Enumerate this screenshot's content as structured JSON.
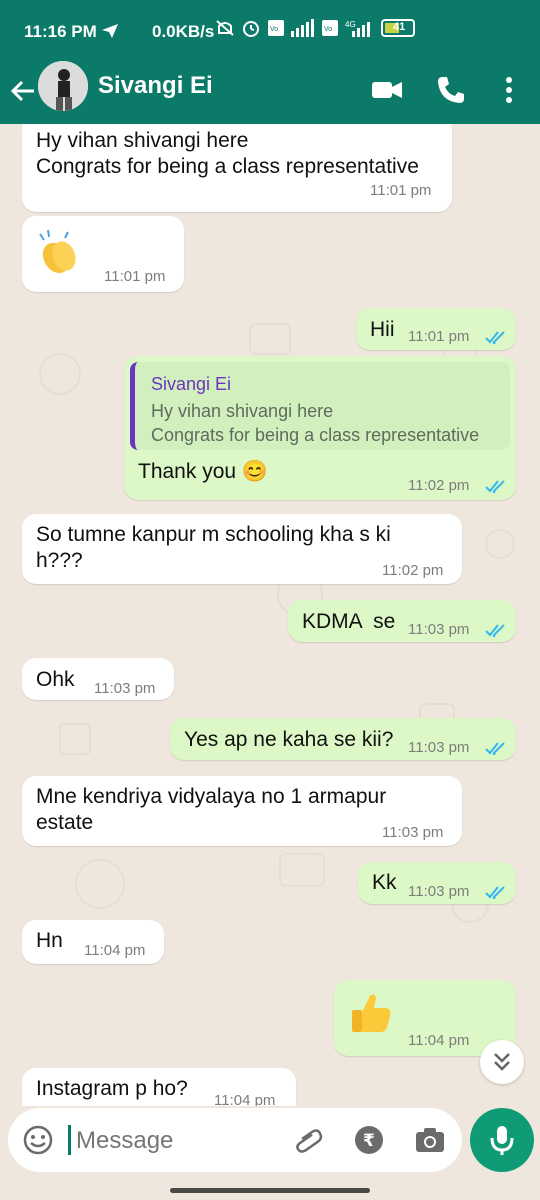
{
  "status_bar": {
    "time": "11:16 PM",
    "speed": "0.0KB/s",
    "battery": "41"
  },
  "header": {
    "contact_name": "Sivangi Ei"
  },
  "messages": [
    {
      "text": "Hy vihan shivangi here\nCongrats for being a class representative",
      "time": "11:01 pm",
      "direction": "incoming"
    },
    {
      "emoji": "clapping-hands",
      "time": "11:01 pm",
      "direction": "incoming"
    },
    {
      "text": "Hii",
      "time": "11:01 pm",
      "direction": "outgoing"
    },
    {
      "reply_name": "Sivangi Ei",
      "reply_text": "Hy vihan shivangi here\nCongrats for being a class representative",
      "text": "Thank you 😊",
      "time": "11:02 pm",
      "direction": "outgoing"
    },
    {
      "text": "So tumne kanpur m schooling kha s ki\nh???",
      "time": "11:02 pm",
      "direction": "incoming"
    },
    {
      "text": "KDMA  se",
      "time": "11:03 pm",
      "direction": "outgoing"
    },
    {
      "text": "Ohk",
      "time": "11:03 pm",
      "direction": "incoming"
    },
    {
      "text": "Yes ap ne kaha se kii?",
      "time": "11:03 pm",
      "direction": "outgoing"
    },
    {
      "text": "Mne kendriya vidyalaya no 1 armapur\nestate",
      "time": "11:03 pm",
      "direction": "incoming"
    },
    {
      "text": "Kk",
      "time": "11:03 pm",
      "direction": "outgoing"
    },
    {
      "text": "Hn",
      "time": "11:04 pm",
      "direction": "incoming"
    },
    {
      "emoji": "thumbs-up",
      "time": "11:04 pm",
      "direction": "outgoing"
    },
    {
      "text": "Instagram p ho?",
      "time": "11:04 pm",
      "direction": "incoming"
    }
  ],
  "composer": {
    "placeholder": "Message"
  },
  "colors": {
    "header": "#0c7a68",
    "incoming_bubble": "#ffffff",
    "outgoing_bubble": "#dcf8c6",
    "read_ticks": "#34b7f1",
    "mic_button": "#0f9b76"
  }
}
